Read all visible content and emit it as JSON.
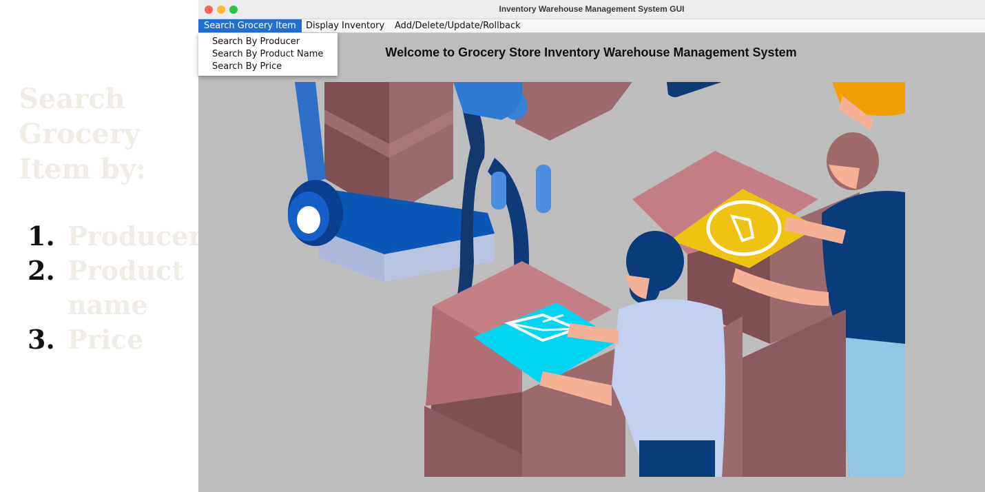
{
  "sidebar": {
    "title": "Search Grocery Item by:",
    "items": [
      {
        "num": "1.",
        "label": "Producer"
      },
      {
        "num": "2.",
        "label": "Product name"
      },
      {
        "num": "3.",
        "label": "Price"
      }
    ]
  },
  "window": {
    "title": "Inventory Warehouse Management System GUI",
    "menus": [
      "Search Grocery Item",
      "Display Inventory",
      "Add/Delete/Update/Rollback"
    ],
    "active_menu": "Search Grocery Item",
    "dropdown": [
      "Search By Producer",
      "Search By Product Name",
      "Search By Price"
    ],
    "welcome": "Welcome to Grocery Store Inventory Warehouse Management System"
  },
  "colors": {
    "menu_active": "#1f6fd6",
    "window_bg": "#bdbdbd",
    "box": "#9e6a6d",
    "robot": "#0a57b8",
    "envelope_card": "#00d5f2",
    "lock_card": "#eec30f"
  },
  "icons": [
    "close-light",
    "minimize-light",
    "zoom-light",
    "envelope-icon",
    "lock-icon"
  ]
}
